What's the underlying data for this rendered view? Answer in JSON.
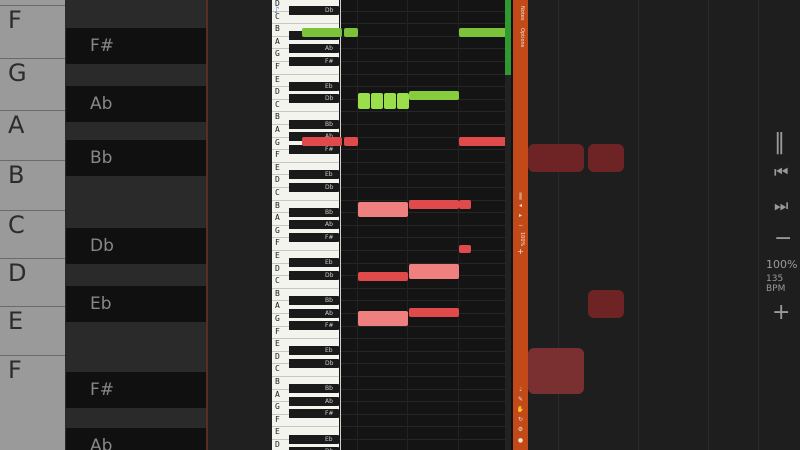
{
  "background": {
    "left_white_key_letters": [
      "F",
      "G",
      "A",
      "B",
      "C",
      "D",
      "E",
      "F"
    ],
    "left_black_key_labels": [
      "F#",
      "Ab",
      "Bb",
      "Db",
      "Eb",
      "F#",
      "Ab"
    ],
    "right_controls": {
      "pause_icon": "pause-icon",
      "prev_icon": "skip-back-icon",
      "next_icon": "skip-forward-icon",
      "minus_label": "−",
      "speed": "100%",
      "bpm": "135 BPM",
      "plus_label": "+"
    }
  },
  "keyboard": {
    "white_key_letters": [
      "D",
      "C",
      "B",
      "A",
      "G",
      "F",
      "E",
      "D",
      "C",
      "B",
      "A",
      "G",
      "F",
      "E",
      "D",
      "C",
      "B",
      "A",
      "G",
      "F",
      "E",
      "D",
      "C",
      "B",
      "A",
      "G",
      "F",
      "E",
      "D",
      "C",
      "B",
      "A",
      "G",
      "F",
      "E",
      "D",
      "C"
    ],
    "black_key_labels": [
      "Db",
      "Bb",
      "Ab",
      "F#",
      "Eb",
      "Db",
      "Bb",
      "Ab",
      "F#",
      "Eb",
      "Db",
      "Bb",
      "Ab",
      "F#",
      "Eb",
      "Db",
      "Bb",
      "Ab",
      "F#",
      "Eb",
      "Db",
      "Bb",
      "Ab",
      "F#",
      "Eb",
      "Db"
    ]
  },
  "sidebar": {
    "top_labels": [
      "Notes",
      "Options"
    ],
    "speed": "100%",
    "controls": [
      "pause",
      "prev",
      "next",
      "minus",
      "plus"
    ],
    "bottom_icons": [
      "metronome-icon",
      "pencil-icon",
      "hand-icon",
      "loop-icon",
      "settings-icon",
      "record-icon"
    ]
  },
  "colors": {
    "right_hand": "#8ed23c",
    "left_hand": "#e24a4a",
    "left_hand_light": "#f07a7a",
    "accent_bar": "#c24a18",
    "scroll_thumb": "#2f9a2f"
  }
}
